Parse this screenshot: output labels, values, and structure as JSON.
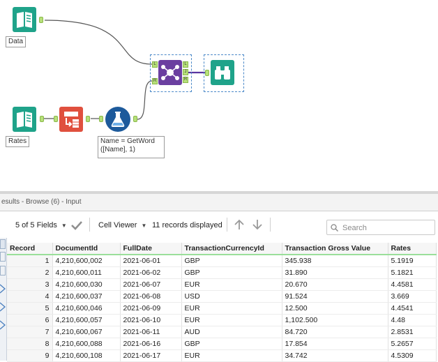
{
  "canvas": {
    "tools": {
      "data_input": {
        "label": "Data",
        "icon": "book-input-icon"
      },
      "rates_input": {
        "label": "Rates",
        "icon": "book-input-icon"
      },
      "text_to_columns": {
        "icon": "text-to-columns-icon"
      },
      "formula": {
        "label": "Name = GetWord\n([Name], 1)",
        "icon": "formula-flask-icon"
      },
      "join": {
        "icon": "join-icon",
        "anchors_in": [
          "L",
          "R"
        ],
        "anchors_out": [
          "L",
          "J",
          "R"
        ]
      },
      "browse": {
        "icon": "binoculars-icon"
      }
    },
    "colors": {
      "input": "#1fa38a",
      "join": "#6b3fa0",
      "browse": "#1fa38a",
      "formula": "#1d5a9b",
      "parse": "#e0503e",
      "wire": "#555555",
      "anchor": "#b7e07a"
    }
  },
  "results": {
    "title": "esults - Browse (6) - Input",
    "toolbar": {
      "fields_label": "5 of 5 Fields",
      "cell_viewer_label": "Cell Viewer",
      "records_displayed": "11 records displayed",
      "search_placeholder": "Search"
    },
    "columns": [
      "Record",
      "DocumentId",
      "FullDate",
      "TransactionCurrencyId",
      "Transaction Gross Value",
      "Rates"
    ],
    "rows": [
      [
        "1",
        "4,210,600,002",
        "2021-06-01",
        "GBP",
        "345.938",
        "5.1919"
      ],
      [
        "2",
        "4,210,600,011",
        "2021-06-02",
        "GBP",
        "31.890",
        "5.1821"
      ],
      [
        "3",
        "4,210,600,030",
        "2021-06-07",
        "EUR",
        "20.670",
        "4.4581"
      ],
      [
        "4",
        "4,210,600,037",
        "2021-06-08",
        "USD",
        "91.524",
        "3.669"
      ],
      [
        "5",
        "4,210,600,046",
        "2021-06-09",
        "EUR",
        "12.500",
        "4.4541"
      ],
      [
        "6",
        "4,210,600,057",
        "2021-06-10",
        "EUR",
        "1,102.500",
        "4.48"
      ],
      [
        "7",
        "4,210,600,067",
        "2021-06-11",
        "AUD",
        "84.720",
        "2.8531"
      ],
      [
        "8",
        "4,210,600,088",
        "2021-06-16",
        "GBP",
        "17.854",
        "5.2657"
      ],
      [
        "9",
        "4,210,600,108",
        "2021-06-17",
        "EUR",
        "34.742",
        "4.5309"
      ]
    ]
  }
}
